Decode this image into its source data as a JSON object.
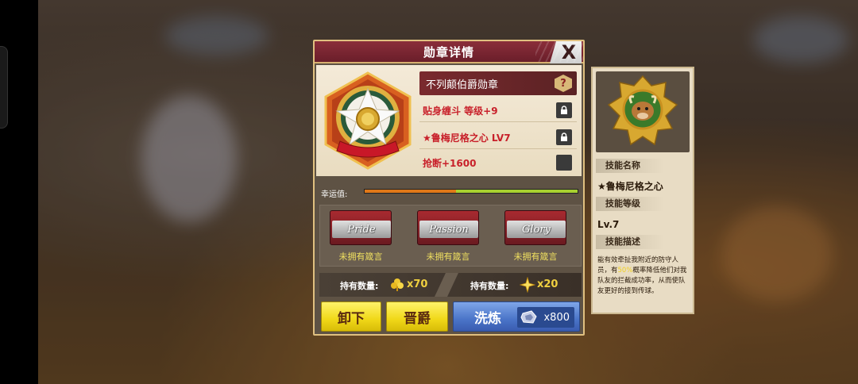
{
  "panel": {
    "title": "勋章详情",
    "close_label": "X"
  },
  "medal": {
    "name": "不列颠伯爵勋章",
    "help_label": "?",
    "attributes": [
      {
        "text": "贴身缠斗 等级+9",
        "state": "locked"
      },
      {
        "text": "★鲁梅尼格之心 LV7",
        "state": "locked"
      },
      {
        "text": "抢断+1600",
        "state": "empty"
      }
    ]
  },
  "luck": {
    "label": "幸运值:",
    "orange_fraction": 0.43,
    "green_fraction": 0.57
  },
  "mottos": [
    {
      "banner": "Pride",
      "caption": "未拥有箴言"
    },
    {
      "banner": "Passion",
      "caption": "未拥有箴言"
    },
    {
      "banner": "Glory",
      "caption": "未拥有箴言"
    }
  ],
  "holdings": [
    {
      "label": "持有数量:",
      "value": "x70",
      "icon": "gold-clover-icon"
    },
    {
      "label": "持有数量:",
      "value": "x20",
      "icon": "gold-sparkle-icon"
    }
  ],
  "buttons": {
    "unequip": "卸下",
    "promote": "晋爵",
    "refine": "洗炼",
    "refine_cost": "x800"
  },
  "skill": {
    "name_tag": "技能名称",
    "name": "★鲁梅尼格之心",
    "level_tag": "技能等级",
    "level": "Lv.7",
    "desc_tag": "技能描述",
    "desc_a": "能有效牵扯我附近的防守人员，有",
    "desc_highlight": "50%",
    "desc_b": "概率降低他们对我队友的拦截成功率，从而使队友更好的接到传球。"
  },
  "colors": {
    "header": "#8a2e3a",
    "attribute_text": "#c8202a",
    "caption": "#f0e060",
    "button_yellow": "#f0d818",
    "button_blue": "#4a74c8"
  }
}
